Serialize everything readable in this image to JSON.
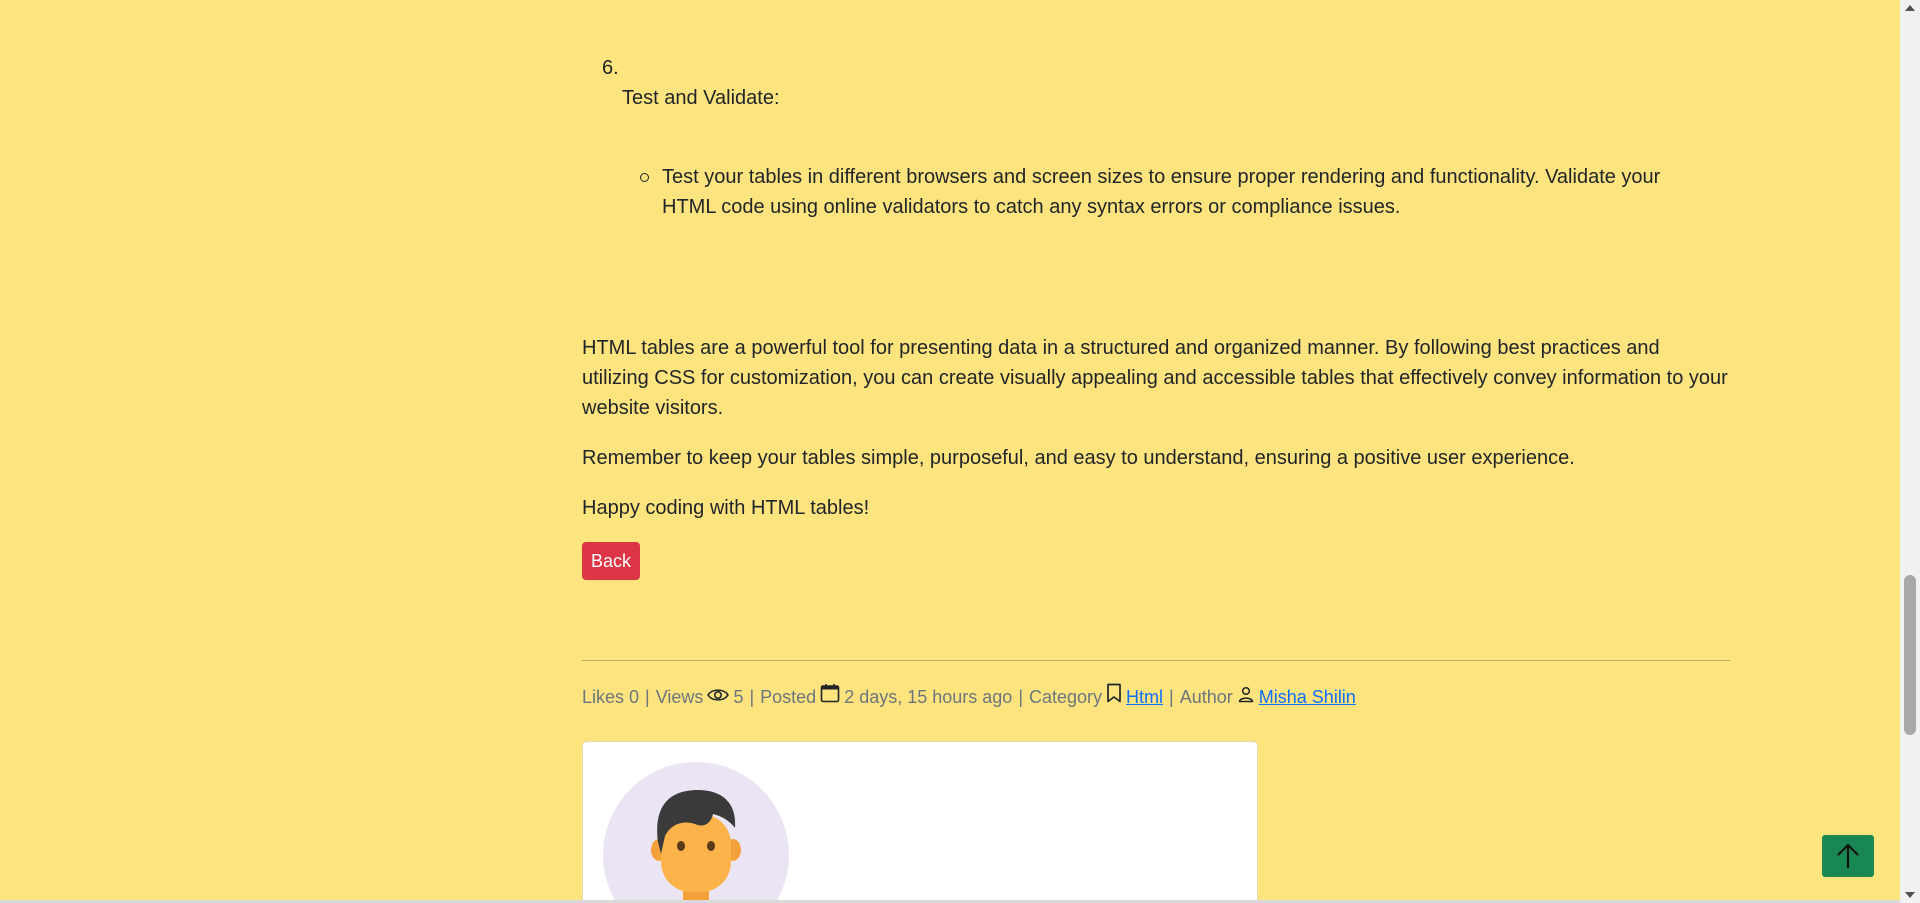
{
  "article": {
    "list_item_number": "6.",
    "list_item_title": "Test and Validate:",
    "list_item_detail": "Test your tables in different browsers and screen sizes to ensure proper rendering and functionality. Validate your HTML code using online validators to catch any syntax errors or compliance issues.",
    "paragraphs": [
      "HTML tables are a powerful tool for presenting data in a structured and organized manner. By following best practices and utilizing CSS for customization, you can create visually appealing and accessible tables that effectively convey information to your website visitors.",
      "Remember to keep your tables simple, purposeful, and easy to understand, ensuring a positive user experience.",
      "Happy coding with HTML tables!"
    ],
    "back_label": "Back"
  },
  "meta": {
    "likes_text": "Likes 0",
    "sep1": "|",
    "views_label": "Views",
    "views_icon": "eye-icon",
    "views_count": "5",
    "sep2": "|",
    "posted_label": "Posted",
    "posted_icon": "calendar-icon",
    "posted_value": "2 days, 15 hours ago",
    "sep3": "|",
    "category_label": "Category",
    "category_icon": "bookmark-icon",
    "category_value": "Html",
    "sep4": "|",
    "author_label": "Author",
    "author_icon": "person-icon",
    "author_value": "Misha Shilin"
  },
  "author_card": {
    "avatar_icon": "avatar-illustration"
  },
  "controls": {
    "scroll_top_icon": "arrow-up-icon"
  },
  "colors": {
    "page_background": "#fde47f",
    "back_button": "#dc3545",
    "scroll_top_button": "#198754",
    "link": "#0d6efd"
  }
}
